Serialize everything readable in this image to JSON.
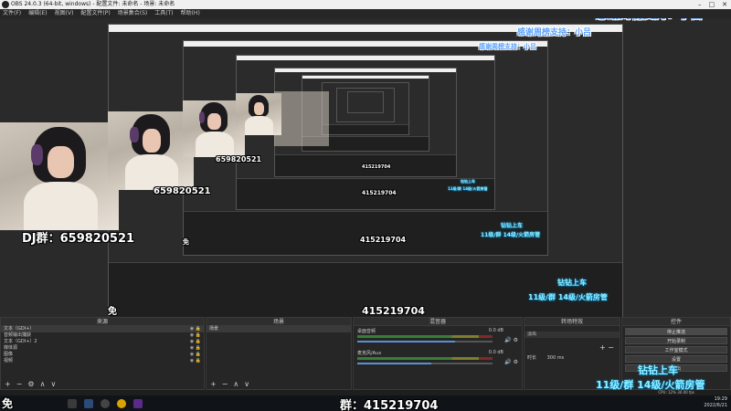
{
  "window": {
    "title": "OBS 24.0.3 (64-bit, windows) - 配置文件: 未命名 - 场景: 未命名"
  },
  "menu": [
    "文件(F)",
    "编辑(E)",
    "视图(V)",
    "配置文件(P)",
    "场景集合(S)",
    "工具(T)",
    "帮助(H)"
  ],
  "overlay": {
    "thanks": "感谢周榜支持：小吕",
    "dj_group": "DJ群：659820521",
    "dj_group_number": "659820521",
    "qq_group": "群：415219704",
    "qq_group_big": "415219704",
    "neon_line1": "钻钻上车",
    "neon_line2": "11级/群 14级/火箭房管",
    "free_prefix": "免"
  },
  "docks": {
    "sources": {
      "title": "来源",
      "items": [
        "文本（GDI+）",
        "音频输出捕获",
        "文本（GDI+）2",
        "媒体源",
        "图像",
        "视频"
      ]
    },
    "scenes": {
      "title": "场景",
      "items": [
        "场景"
      ]
    },
    "mixer": {
      "title": "混音器",
      "channels": [
        {
          "name": "桌面音频",
          "db": "0.0 dB",
          "level": 0.72
        },
        {
          "name": "麦克风/Aux",
          "db": "0.0 dB",
          "level": 0.55
        }
      ]
    },
    "transitions": {
      "title": "转场特效",
      "type": "淡出",
      "duration_label": "时长",
      "duration_value": "300 ms"
    },
    "controls": {
      "title": "控件",
      "buttons": [
        "停止推流",
        "开始录制",
        "工作室模式",
        "设置",
        "退出"
      ]
    }
  },
  "status": {
    "fps": "CPU: 12% 30.00 fps"
  },
  "taskbar": {
    "time": "19:29",
    "date": "2022/6/21"
  }
}
